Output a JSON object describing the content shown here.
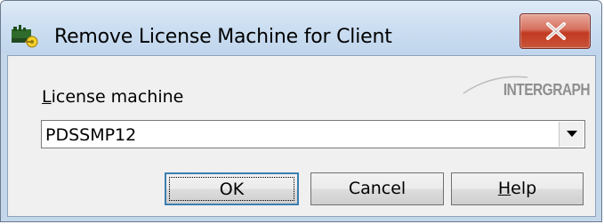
{
  "window": {
    "title": "Remove License Machine for Client",
    "close_glyph": "X"
  },
  "logo": {
    "text": "INTERGRAPH"
  },
  "form": {
    "label_first": "L",
    "label_rest": "icense machine",
    "machine_value": "PDSSMP12"
  },
  "buttons": {
    "ok_label": "OK",
    "cancel_label": "Cancel",
    "help_first": "H",
    "help_rest": "elp"
  },
  "colors": {
    "titlebar": "#cddff2",
    "close_button": "#c23a22",
    "client_bg": "#f0f0f0",
    "default_button_border": "#3c7fb1"
  },
  "icons": [
    "app-icon",
    "close-icon",
    "dropdown-arrow-icon"
  ]
}
